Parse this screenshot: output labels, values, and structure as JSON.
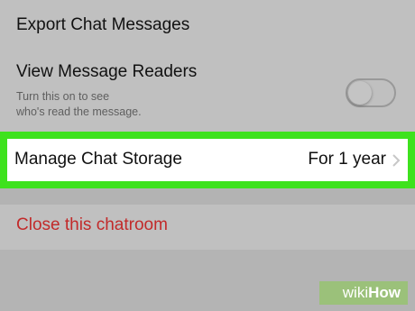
{
  "settings": {
    "export_label": "Export Chat Messages",
    "readers_label": "View Message Readers",
    "readers_desc_line1": "Turn this on to see",
    "readers_desc_line2": "who's read the message.",
    "readers_toggle": "off",
    "storage_label": "Manage Chat Storage",
    "storage_value": "For 1 year",
    "close_label": "Close this chatroom"
  },
  "watermark": {
    "wiki": "wiki",
    "how": "How"
  },
  "colors": {
    "highlight": "#3ee21e",
    "danger_text": "#c22a2a",
    "watermark_bg": "#9bc17a"
  },
  "icons": {
    "storage_chevron": "chevron-right-icon"
  }
}
